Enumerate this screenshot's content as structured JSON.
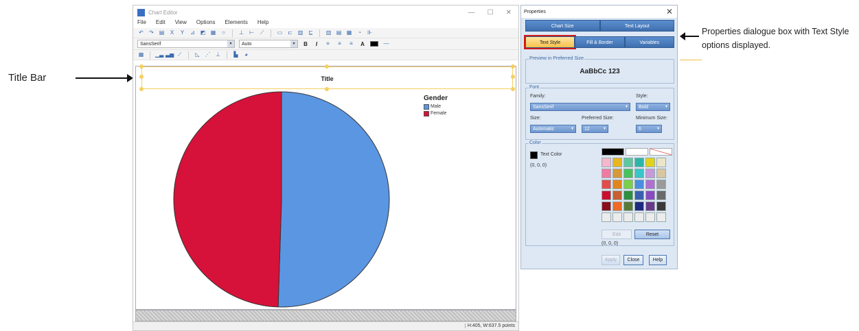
{
  "annotations": {
    "title_bar_note": "Title Bar",
    "properties_note": "Properties dialogue box with Text Style options displayed."
  },
  "chart_editor": {
    "window_title": "Chart Editor",
    "app_icon_text": "Chart",
    "window_controls": [
      "—",
      "☐",
      "✕"
    ],
    "menu": [
      "File",
      "Edit",
      "View",
      "Options",
      "Elements",
      "Help"
    ],
    "font_toolbar": {
      "font_family": "SansSerif",
      "font_size": "Auto",
      "bold": "B",
      "italic": "I",
      "text_label": "A"
    },
    "status": "H:405, W:637.5 points"
  },
  "chart_data": {
    "type": "pie",
    "title": "Title",
    "legend_title": "Gender",
    "legend_position": "top-right",
    "categories": [
      "Male",
      "Female"
    ],
    "values": [
      50.5,
      49.5
    ],
    "colors": [
      "#5b96e2",
      "#d6123a"
    ]
  },
  "properties": {
    "window_title": "Properties",
    "close_glyph": "✕",
    "tabs_row1": [
      "Chart Size",
      "Text Layout"
    ],
    "tabs_row2": [
      "Text Style",
      "Fill & Border",
      "Variables"
    ],
    "active_tab": "Text Style",
    "preview_group": "Preview in Preferred Size",
    "preview_text": "AaBbCc 123",
    "font_group": "Font",
    "family_label": "Family:",
    "family_value": "SansSerif",
    "style_label": "Style:",
    "style_value": "Bold",
    "size_label": "Size:",
    "size_value": "Automatic",
    "preferred_size_label": "Preferred Size:",
    "preferred_size_value": "12",
    "minimum_size_label": "Minimum Size:",
    "minimum_size_value": "6",
    "color_group": "Color",
    "text_color_label": "Text Color",
    "text_color_rgb": "(0, 0, 0)",
    "palette_rgb": "(0, 0, 0)",
    "edit_label": "Edit",
    "reset_label": "Reset",
    "apply_label": "Apply",
    "close_label": "Close",
    "help_label": "Help",
    "palette_top": [
      "#000000",
      "#ffffff",
      "none"
    ],
    "palette": [
      "#f6b7cc",
      "#e8b620",
      "#5ec8a0",
      "#2cb6a8",
      "#e3d21a",
      "#ece6c8",
      "#f07aa0",
      "#d59a3a",
      "#49c25c",
      "#38c6c6",
      "#c69ad8",
      "#d8c6a0",
      "#e24c4c",
      "#e2861c",
      "#7ad04a",
      "#4a8ee0",
      "#b070d0",
      "#9a9a9a",
      "#c8102e",
      "#c86030",
      "#2c9040",
      "#3a5fb0",
      "#8a4ac0",
      "#6a6a6a",
      "#8a0e1a",
      "#f06a26",
      "#5a7a3a",
      "#1e2a80",
      "#6a3a8a",
      "#3a3a3a",
      "#ececec",
      "#ececec",
      "#ececec",
      "#ececec",
      "#ececec",
      "#ececec"
    ]
  }
}
